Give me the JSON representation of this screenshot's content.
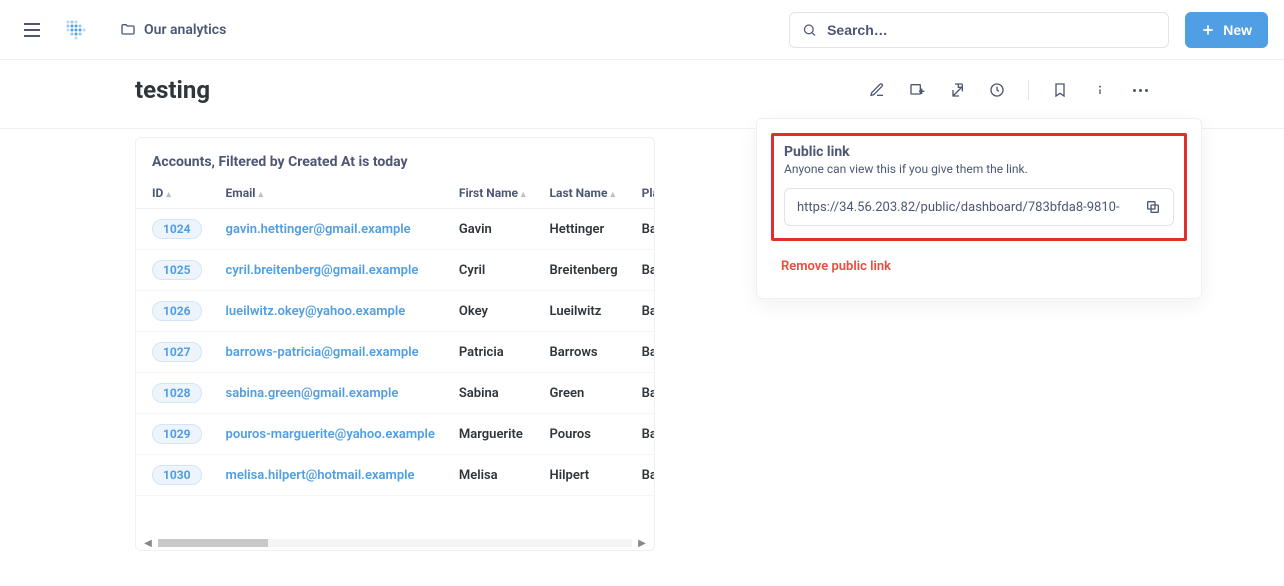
{
  "header": {
    "breadcrumb": "Our analytics",
    "search_placeholder": "Search…",
    "new_button": "New"
  },
  "title": "testing",
  "card": {
    "subtitle": "Accounts, Filtered by Created At is today",
    "columns": [
      "ID",
      "Email",
      "First Name",
      "Last Name",
      "Plan"
    ],
    "rows": [
      {
        "id": "1024",
        "email": "gavin.hettinger@gmail.example",
        "first": "Gavin",
        "last": "Hettinger",
        "plan": "Basi"
      },
      {
        "id": "1025",
        "email": "cyril.breitenberg@gmail.example",
        "first": "Cyril",
        "last": "Breitenberg",
        "plan": "Basi"
      },
      {
        "id": "1026",
        "email": "lueilwitz.okey@yahoo.example",
        "first": "Okey",
        "last": "Lueilwitz",
        "plan": "Basi"
      },
      {
        "id": "1027",
        "email": "barrows-patricia@gmail.example",
        "first": "Patricia",
        "last": "Barrows",
        "plan": "Basi"
      },
      {
        "id": "1028",
        "email": "sabina.green@gmail.example",
        "first": "Sabina",
        "last": "Green",
        "plan": "Basi"
      },
      {
        "id": "1029",
        "email": "pouros-marguerite@yahoo.example",
        "first": "Marguerite",
        "last": "Pouros",
        "plan": "Basi"
      },
      {
        "id": "1030",
        "email": "melisa.hilpert@hotmail.example",
        "first": "Melisa",
        "last": "Hilpert",
        "plan": "Basi"
      }
    ]
  },
  "panel": {
    "title": "Public link",
    "subtitle": "Anyone can view this if you give them the link.",
    "url": "https://34.56.203.82/public/dashboard/783bfda8-9810-",
    "remove": "Remove public link"
  }
}
